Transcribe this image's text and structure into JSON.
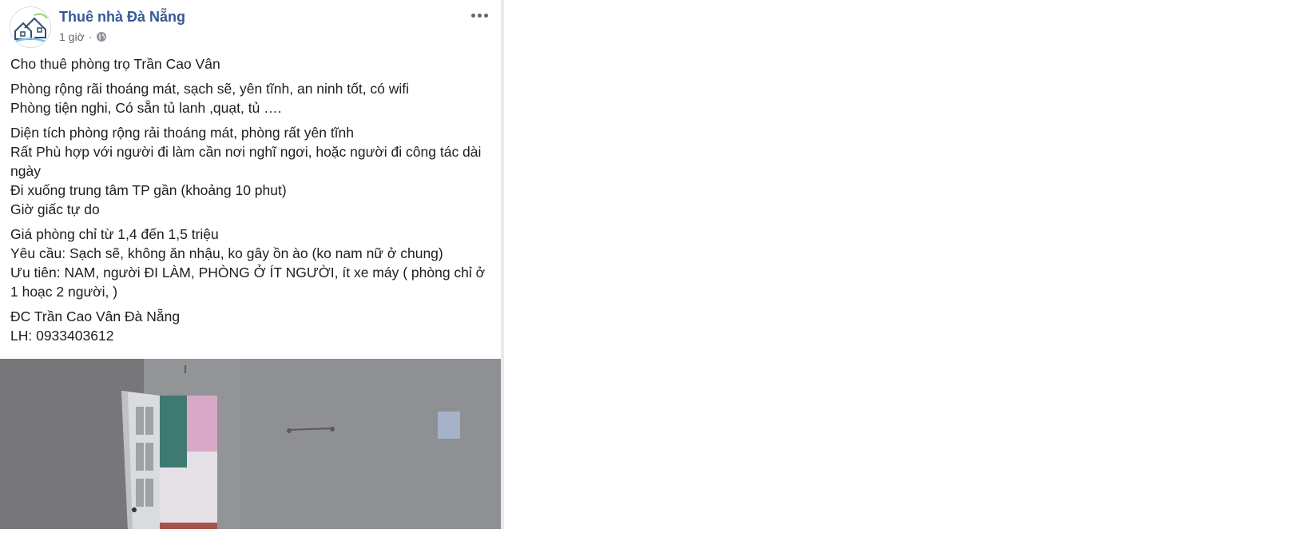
{
  "post": {
    "page_name": "Thuê nhà Đà Nẵng",
    "timestamp": "1 giờ",
    "separator": "·",
    "audience_icon": "globe-icon",
    "more_icon": "more-options-icon",
    "paragraphs": [
      [
        "Cho thuê phòng trọ Trần Cao Vân"
      ],
      [
        "Phòng rộng rãi thoáng mát, sạch sẽ, yên tĩnh, an ninh tốt, có wifi",
        "Phòng tiện nghi, Có sẵn tủ lanh ,quạt, tủ …."
      ],
      [
        "Diện tích phòng rộng rải thoáng mát, phòng rất yên tĩnh",
        "Rất Phù hợp với người đi làm cần nơi nghĩ ngơi, hoặc người đi công tác dài ngày",
        "Đi xuống trung tâm TP gần (khoảng 10 phut)",
        "Giờ giấc tự do"
      ],
      [
        "Giá phòng chỉ từ 1,4 đến 1,5 triệu",
        "Yêu cầu: Sạch sẽ, không ăn nhậu, ko gây ồn ào (ko nam nữ ở chung)",
        "Ưu tiên: NAM, người ĐI LÀM, PHÒNG Ở ÍT NGƯỜI, ít xe máy ( phòng chỉ ở 1 hoạc 2 người, )"
      ],
      [
        "ĐC Trần Cao Vân Đà Nẵng",
        "LH: 0933403612"
      ]
    ]
  },
  "colors": {
    "link": "#385898",
    "meta": "#616770",
    "text": "#1c1e21",
    "divider": "#e9ebee"
  }
}
